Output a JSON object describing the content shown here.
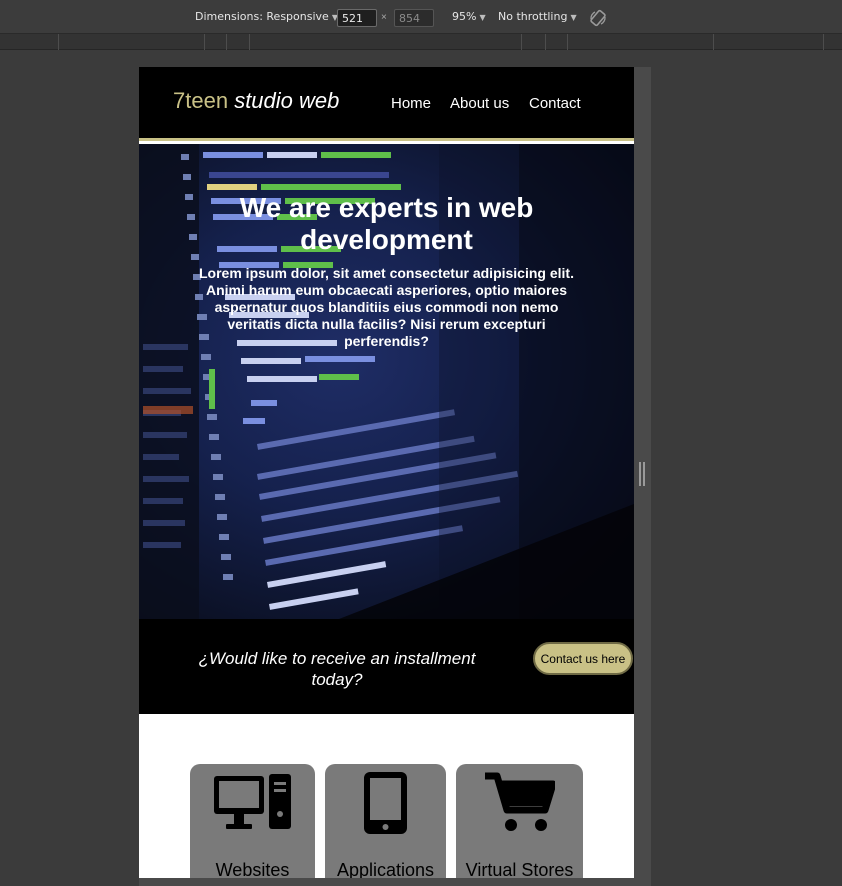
{
  "devtools": {
    "dimensions_label": "Dimensions: Responsive",
    "width_value": "521",
    "height_value": "854",
    "times_sign": "×",
    "zoom": "95%",
    "throttling": "No throttling",
    "rotate_icon": "rotate-icon"
  },
  "site": {
    "logo_brand": "7teen",
    "logo_rest": "studio web",
    "nav": [
      "Home",
      "About us",
      "Contact"
    ],
    "hero_title": "We are experts in web development",
    "hero_text": "Lorem ipsum dolor, sit amet consectetur adipisicing elit. Animi harum eum obcaecati asperiores, optio maiores aspernatur quos blanditiis eius commodi non nemo veritatis dicta nulla facilis? Nisi rerum excepturi perferendis?",
    "cta_text": "¿Would like to receive an installment today?",
    "cta_button": "Contact us here",
    "services": [
      {
        "title": "Websites",
        "icon": "desktop-computer-icon"
      },
      {
        "title": "Applications",
        "icon": "mobile-phone-icon"
      },
      {
        "title": "Virtual Stores",
        "icon": "shopping-cart-icon"
      }
    ]
  },
  "colors": {
    "accent": "#c9c186",
    "header_bg": "#000000",
    "card_bg": "#7a7a7a",
    "devtools_bg": "#3c3c3c"
  }
}
